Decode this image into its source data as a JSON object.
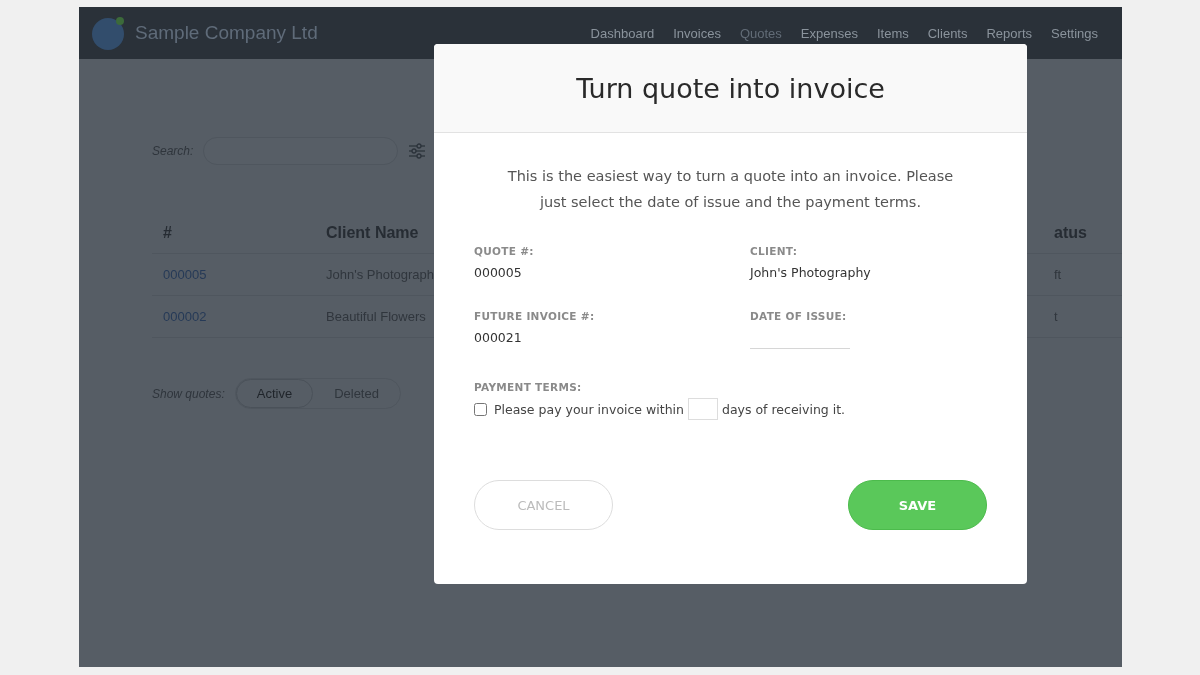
{
  "header": {
    "company": "Sample Company Ltd",
    "nav": [
      {
        "label": "Dashboard",
        "selected": false
      },
      {
        "label": "Invoices",
        "selected": false
      },
      {
        "label": "Quotes",
        "selected": true
      },
      {
        "label": "Expenses",
        "selected": false
      },
      {
        "label": "Items",
        "selected": false
      },
      {
        "label": "Clients",
        "selected": false
      },
      {
        "label": "Reports",
        "selected": false
      },
      {
        "label": "Settings",
        "selected": false
      }
    ]
  },
  "search": {
    "label": "Search:"
  },
  "table": {
    "columns": [
      "#",
      "Client Name",
      "atus"
    ],
    "rows": [
      [
        "000005",
        "John's Photograph",
        "ft"
      ],
      [
        "000002",
        "Beautiful Flowers",
        "t"
      ]
    ]
  },
  "filter": {
    "label": "Show quotes:",
    "options": [
      {
        "label": "Active",
        "selected": true
      },
      {
        "label": "Deleted",
        "selected": false
      }
    ]
  },
  "modal": {
    "title": "Turn quote into invoice",
    "intro": "This is the easiest way to turn a quote into an invoice. Please just select the date of issue and the payment terms.",
    "fields": [
      {
        "kind": "text",
        "label": "QUOTE #:",
        "value": "000005"
      },
      {
        "kind": "text",
        "label": "CLIENT:",
        "value": "John's Photography"
      },
      {
        "kind": "text",
        "label": "FUTURE INVOICE #:",
        "value": "000021"
      },
      {
        "kind": "input",
        "label": "DATE OF ISSUE:"
      }
    ],
    "payment_terms": {
      "label": "PAYMENT TERMS:",
      "checked": false,
      "before": "Please pay your invoice within",
      "after": "days of receiving it."
    },
    "buttons": [
      {
        "kind": "secondary",
        "label": "CANCEL"
      },
      {
        "kind": "primary",
        "label": "SAVE"
      }
    ]
  }
}
